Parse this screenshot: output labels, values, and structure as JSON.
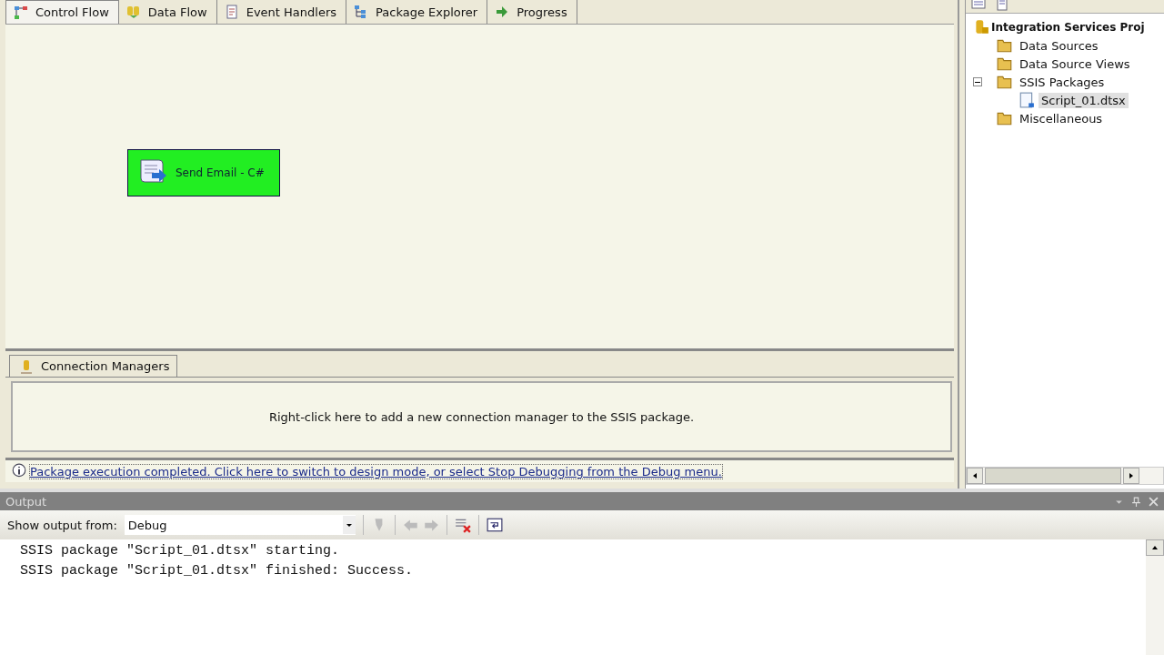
{
  "designer": {
    "tabs": [
      {
        "label": "Control Flow",
        "selected": true
      },
      {
        "label": "Data Flow",
        "selected": false
      },
      {
        "label": "Event Handlers",
        "selected": false
      },
      {
        "label": "Package Explorer",
        "selected": false
      },
      {
        "label": "Progress",
        "selected": false
      }
    ],
    "task": {
      "label": "Send Email - C#"
    },
    "connection_managers": {
      "tab": "Connection Managers",
      "hint": "Right-click here to add a new connection manager to the SSIS package."
    },
    "info_bar": "Package execution completed. Click here to switch to design mode, or select Stop Debugging from the Debug menu."
  },
  "solution_explorer": {
    "tree": [
      {
        "label": "Integration Services Proj",
        "selected": false,
        "children": [
          {
            "label": "Data Sources",
            "selected": false
          },
          {
            "label": "Data Source Views",
            "selected": false
          },
          {
            "label": "SSIS Packages",
            "expanded": true,
            "selected": false,
            "children": [
              {
                "label": "Script_01.dtsx",
                "selected": true
              }
            ]
          },
          {
            "label": "Miscellaneous",
            "selected": false
          }
        ]
      }
    ]
  },
  "output": {
    "title": "Output",
    "show_from_label": "Show output from:",
    "show_from_value": "Debug",
    "lines": [
      "SSIS package \"Script_01.dtsx\" starting.",
      "SSIS package \"Script_01.dtsx\" finished: Success."
    ]
  }
}
